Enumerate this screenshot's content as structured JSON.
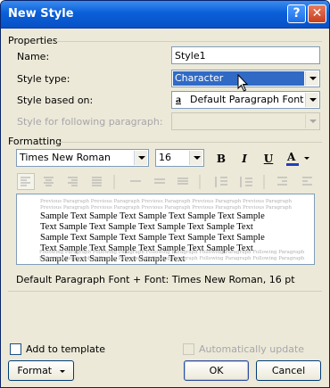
{
  "window": {
    "title": "New Style",
    "help_icon": "?",
    "close_icon": "✕"
  },
  "properties": {
    "group_label": "Properties",
    "name_label": "Name:",
    "name_value": "Style1",
    "type_label": "Style type:",
    "type_value": "Character",
    "based_label": "Style based on:",
    "based_value": "Default Paragraph Font",
    "based_icon": "a",
    "following_label": "Style for following paragraph:",
    "following_value": ""
  },
  "formatting": {
    "group_label": "Formatting",
    "font_value": "Times New Roman",
    "size_value": "16",
    "bold": "B",
    "italic": "I",
    "underline": "U",
    "font_color": "A",
    "color_accent": "#1f3fbf"
  },
  "preview": {
    "ghost_line": "Previous Paragraph Previous Paragraph Previous Paragraph Previous Paragraph Previous Paragraph",
    "sample_lines": [
      "Sample Text Sample Text Sample Text Sample Text Sample",
      "Text Sample Text Sample Text Sample Text Sample Text",
      "Sample Text Sample Text Sample Text Sample Text Sample",
      "Text Sample Text Sample Text Sample Text Sample Text",
      "Sample Text Sample Text Sample Text"
    ],
    "following_line": "Following Paragraph Following Paragraph Following Paragraph Following Paragraph Following Paragraph"
  },
  "description": "Default Paragraph Font + Font: Times New Roman, 16 pt",
  "footer": {
    "add_template_label": "Add to template",
    "auto_update_label": "Automatically update",
    "format_label": "Format",
    "ok_label": "OK",
    "cancel_label": "Cancel"
  }
}
